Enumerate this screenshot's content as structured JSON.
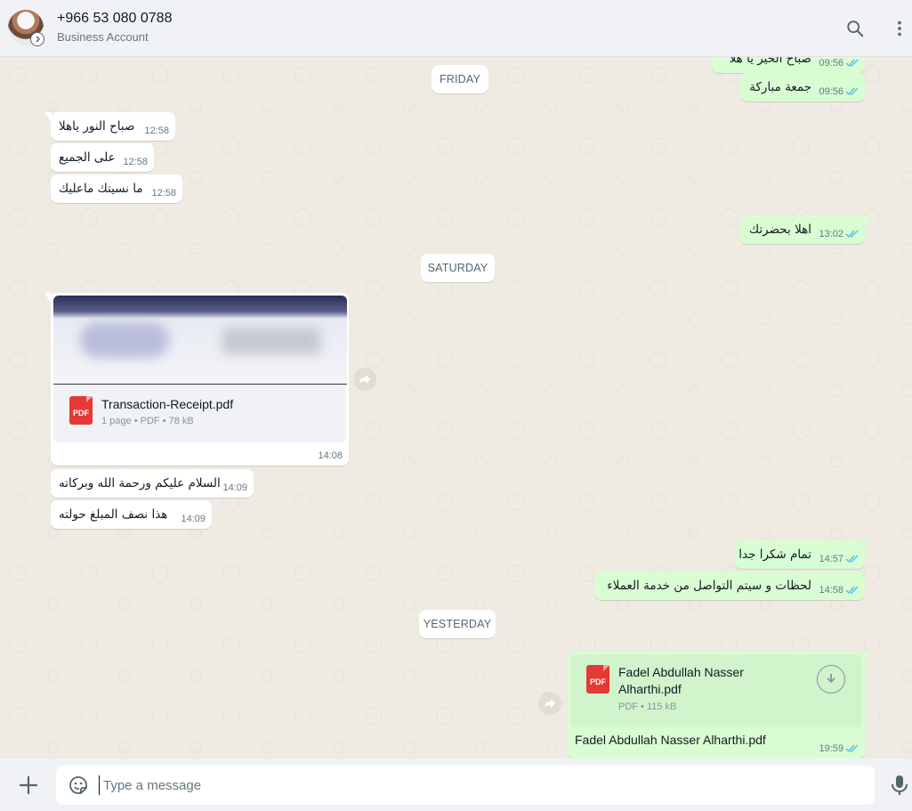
{
  "header": {
    "contact_name": "+966 53 080 0788",
    "subtitle": "Business Account"
  },
  "dates": {
    "friday": "FRIDAY",
    "saturday": "SATURDAY",
    "yesterday": "YESTERDAY"
  },
  "messages": [
    {
      "dir": "out",
      "text": "صباح الخير يا هلا",
      "time": "09:56"
    },
    {
      "dir": "out",
      "text": "جمعة مباركة",
      "time": "09:56"
    },
    {
      "dir": "in",
      "text": "صباح النور ياهلا",
      "time": "12:58"
    },
    {
      "dir": "in",
      "text": "على الجميع",
      "time": "12:58"
    },
    {
      "dir": "in",
      "text": "ما نسيتك ماعليك",
      "time": "12:58"
    },
    {
      "dir": "out",
      "text": "اهلا بحضرتك",
      "time": "13:02"
    },
    {
      "dir": "in",
      "text": "السلام عليكم ورحمة الله وبركاته",
      "time": "14:09"
    },
    {
      "dir": "in",
      "text": "هذا نصف المبلغ حولته",
      "time": "14:09"
    },
    {
      "dir": "out",
      "text": "تمام شكرا جدا",
      "time": "14:57"
    },
    {
      "dir": "out",
      "text": "لحظات و سيتم التواصل من خدمة العملاء",
      "time": "14:58"
    }
  ],
  "doc_in": {
    "file_name": "Transaction-Receipt.pdf",
    "meta": "1 page • PDF • 78 kB",
    "icon_label": "PDF",
    "time": "14:08"
  },
  "doc_out": {
    "file_name_line1": "Fadel Abdullah Nasser",
    "file_name_line2": "Alharthi.pdf",
    "meta": "PDF • 115 kB",
    "icon_label": "PDF",
    "caption": "Fadel Abdullah Nasser Alharthi.pdf",
    "time": "19:59"
  },
  "composer": {
    "placeholder": "Type a message"
  },
  "colors": {
    "incoming_bubble": "#ffffff",
    "outgoing_bubble": "#d9fdd3",
    "read_ticks": "#53bdeb",
    "pdf_red": "#e53935"
  }
}
